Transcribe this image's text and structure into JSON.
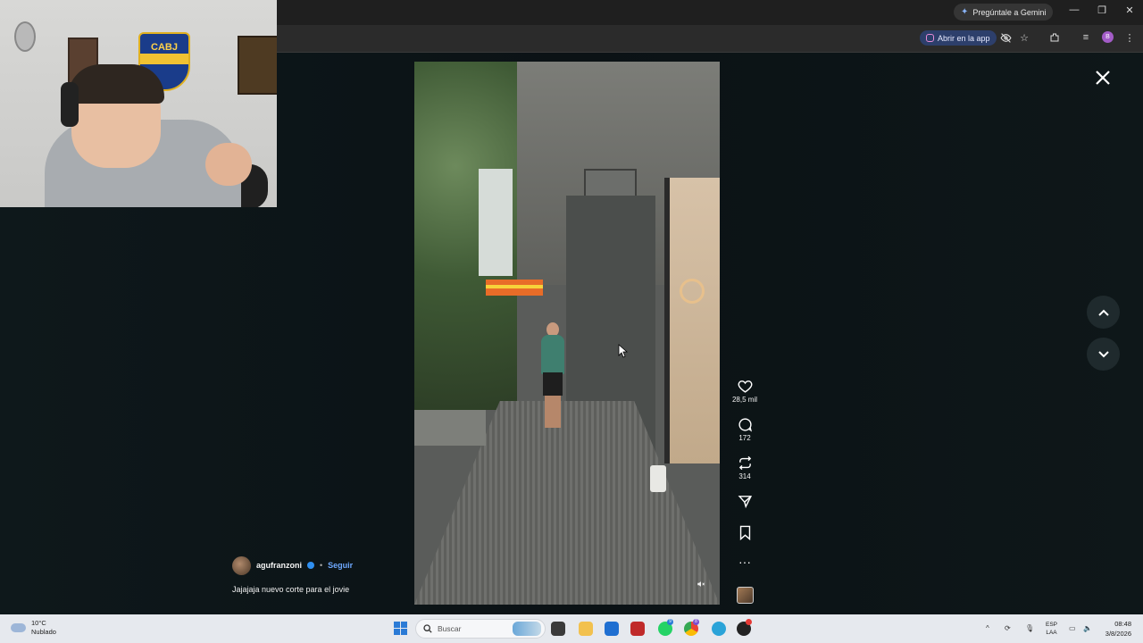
{
  "browser": {
    "gemini_label": "Pregúntale a Gemini",
    "open_app_label": "Abrir en la app",
    "profile_initial": "B"
  },
  "webcam": {
    "shield_text": "CABJ"
  },
  "post": {
    "author": "agufranzoni",
    "separator": "•",
    "follow_label": "Seguir",
    "caption": "Jajajaja nuevo corte para el jovie"
  },
  "actions": {
    "likes": "28,5 mil",
    "comments": "172",
    "reposts": "314"
  },
  "taskbar": {
    "weather_temp": "10°C",
    "weather_desc": "Nublado",
    "search_placeholder": "Buscar",
    "lang_primary": "ESP",
    "lang_secondary": "LAA",
    "time": "08:48",
    "date": "3/8/2026",
    "whatsapp_badge": "9",
    "chrome_badge": "8"
  },
  "colors": {
    "follow": "#6ea8ff",
    "page_bg": "#0d1518",
    "taskbar_bg": "#e6e9ee"
  }
}
